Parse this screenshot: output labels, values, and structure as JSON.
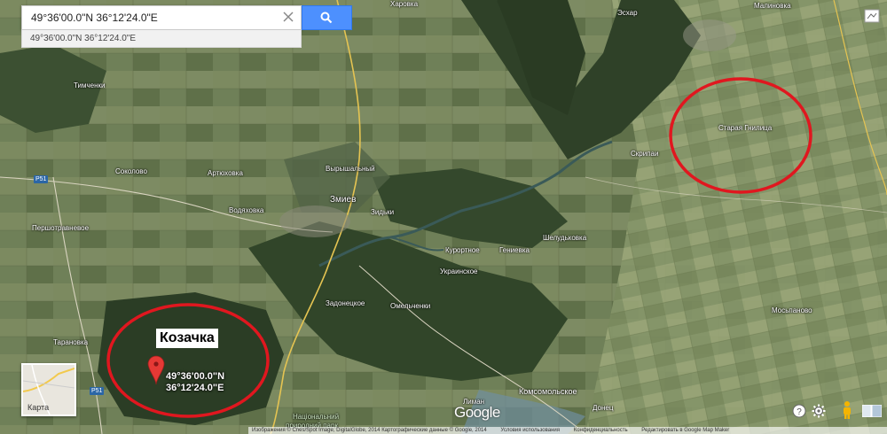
{
  "search": {
    "value": "49°36'00.0\"N 36°12'24.0\"E",
    "suggestion": "49°36'00.0\"N 36°12'24.0\"E"
  },
  "places": {
    "kharovka": "Хаpовка",
    "eskhar": "Эсхар",
    "malinovka": "Малиновка",
    "timchenki": "Тимченки",
    "sokolovo": "Соколово",
    "artyukhovka": "Артюховка",
    "vyryshalny": "Вырышальный",
    "stara_gnilitsa": "Старая Гнилица",
    "skripai": "Скрипаи",
    "vodyanovka": "Водяховка",
    "zmiev": "Змиев",
    "zidki": "Зидьки",
    "pershotravnevoe": "Першотравневое",
    "kurortnoe": "Курортное",
    "genievka": "Гениевка",
    "sheludkovka": "Шелудьковка",
    "ukrainskoe": "Украинское",
    "zadonetskoe": "Задонецкое",
    "omelchenki": "Омельченки",
    "mosplanovo": "Мосьпаново",
    "taranovka": "Тарановка",
    "komsomolskoe": "Комсомольское",
    "liman": "Лиман",
    "donets": "Донец",
    "nat_park_1": "Національний",
    "nat_park_2": "природний парк"
  },
  "routes": {
    "p51_top": "P51",
    "p51_bottom": "P51"
  },
  "marker": {
    "name": "Козачка",
    "lat": "49°36'00.0\"N",
    "lng": "36°12'24.0\"E"
  },
  "thumbnail": {
    "label": "Карта"
  },
  "logo": "Google",
  "attribution": [
    "Изображения © Cnes/Spot Image, DigitalGlobe, 2014 Картографические данные © Google, 2014",
    "Условия использования",
    "Конфиденциальность",
    "Редактировать в Google Map Maker"
  ],
  "colors": {
    "search_button": "#4d90fe",
    "annotation_circle": "#e0171f",
    "marker": "#e53935"
  },
  "icons": [
    "clear-icon",
    "search-icon",
    "help-icon",
    "gear-icon",
    "pegman-icon",
    "map-overview-icon"
  ]
}
